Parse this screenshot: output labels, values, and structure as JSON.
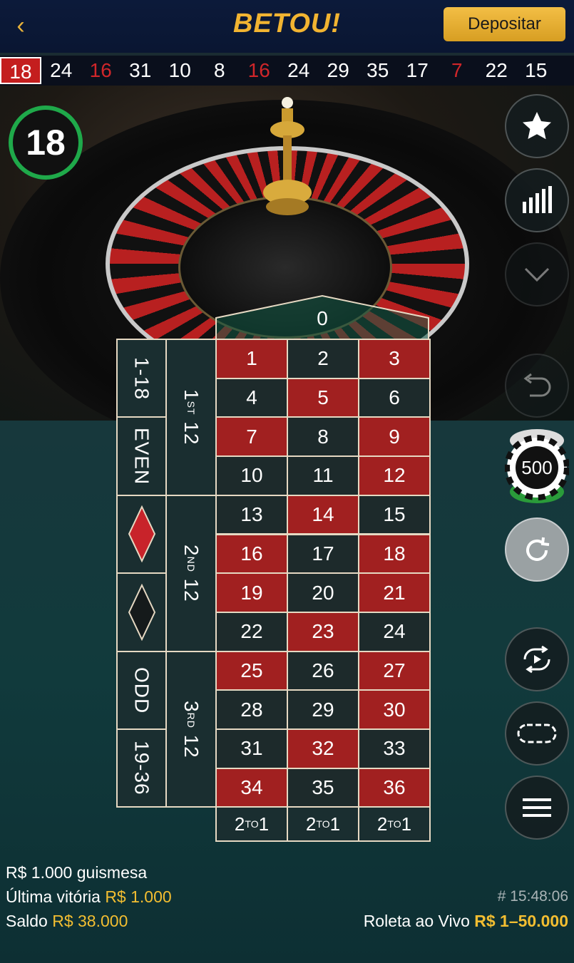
{
  "header": {
    "back_icon": "chevron-left-icon",
    "logo": "BETOU!",
    "deposit_label": "Depositar"
  },
  "history": [
    {
      "n": "18",
      "color": "red",
      "current": true
    },
    {
      "n": "24",
      "color": "black"
    },
    {
      "n": "16",
      "color": "red"
    },
    {
      "n": "31",
      "color": "black"
    },
    {
      "n": "10",
      "color": "black"
    },
    {
      "n": "8",
      "color": "black"
    },
    {
      "n": "16",
      "color": "red"
    },
    {
      "n": "24",
      "color": "black"
    },
    {
      "n": "29",
      "color": "black"
    },
    {
      "n": "35",
      "color": "black"
    },
    {
      "n": "17",
      "color": "black"
    },
    {
      "n": "7",
      "color": "red"
    },
    {
      "n": "22",
      "color": "black"
    },
    {
      "n": "15",
      "color": "black"
    }
  ],
  "timer": {
    "value": "18"
  },
  "right_buttons": [
    {
      "icon": "star-icon"
    },
    {
      "icon": "statistics-icon"
    },
    {
      "icon": "chevron-down-icon"
    },
    {
      "icon": "undo-icon"
    },
    {
      "icon": "chip-stack-icon",
      "value": "500"
    },
    {
      "icon": "repeat-icon"
    },
    {
      "icon": "autoplay-icon"
    },
    {
      "icon": "racetrack-icon"
    },
    {
      "icon": "menu-icon"
    }
  ],
  "table": {
    "zero": "0",
    "numbers": [
      {
        "n": "1",
        "c": "red"
      },
      {
        "n": "2",
        "c": "black"
      },
      {
        "n": "3",
        "c": "red"
      },
      {
        "n": "4",
        "c": "black"
      },
      {
        "n": "5",
        "c": "red"
      },
      {
        "n": "6",
        "c": "black"
      },
      {
        "n": "7",
        "c": "red"
      },
      {
        "n": "8",
        "c": "black"
      },
      {
        "n": "9",
        "c": "red"
      },
      {
        "n": "10",
        "c": "black"
      },
      {
        "n": "11",
        "c": "black"
      },
      {
        "n": "12",
        "c": "red"
      },
      {
        "n": "13",
        "c": "black"
      },
      {
        "n": "14",
        "c": "red"
      },
      {
        "n": "15",
        "c": "black"
      },
      {
        "n": "16",
        "c": "red"
      },
      {
        "n": "17",
        "c": "black"
      },
      {
        "n": "18",
        "c": "red"
      },
      {
        "n": "19",
        "c": "red"
      },
      {
        "n": "20",
        "c": "black"
      },
      {
        "n": "21",
        "c": "red"
      },
      {
        "n": "22",
        "c": "black"
      },
      {
        "n": "23",
        "c": "red"
      },
      {
        "n": "24",
        "c": "black"
      },
      {
        "n": "25",
        "c": "red"
      },
      {
        "n": "26",
        "c": "black"
      },
      {
        "n": "27",
        "c": "red"
      },
      {
        "n": "28",
        "c": "black"
      },
      {
        "n": "29",
        "c": "black"
      },
      {
        "n": "30",
        "c": "red"
      },
      {
        "n": "31",
        "c": "black"
      },
      {
        "n": "32",
        "c": "red"
      },
      {
        "n": "33",
        "c": "black"
      },
      {
        "n": "34",
        "c": "red"
      },
      {
        "n": "35",
        "c": "black"
      },
      {
        "n": "36",
        "c": "red"
      }
    ],
    "outside_left": [
      "1-18",
      "EVEN",
      "red-diamond",
      "black-diamond",
      "ODD",
      "19-36"
    ],
    "dozens": [
      {
        "main": "1",
        "sup": "ST",
        "end": "12"
      },
      {
        "main": "2",
        "sup": "ND",
        "end": "12"
      },
      {
        "main": "3",
        "sup": "RD",
        "end": "12"
      }
    ],
    "columns": [
      {
        "main": "2",
        "sup": "TO",
        "end": "1"
      },
      {
        "main": "2",
        "sup": "TO",
        "end": "1"
      },
      {
        "main": "2",
        "sup": "TO",
        "end": "1"
      }
    ]
  },
  "footer": {
    "limits_table": "R$ 1.000 guismesa",
    "last_win_label": "Última vitória",
    "last_win_value": "R$ 1.000",
    "balance_label": "Saldo",
    "balance_value": "R$ 38.000",
    "time": "# 15:48:06",
    "game_name": "Roleta ao Vivo",
    "game_limits": "R$ 1–50.000"
  },
  "colors": {
    "accent": "#f3be31",
    "red": "#a12020",
    "black": "#1d2a2b",
    "timer_ring": "#1fa94a"
  }
}
